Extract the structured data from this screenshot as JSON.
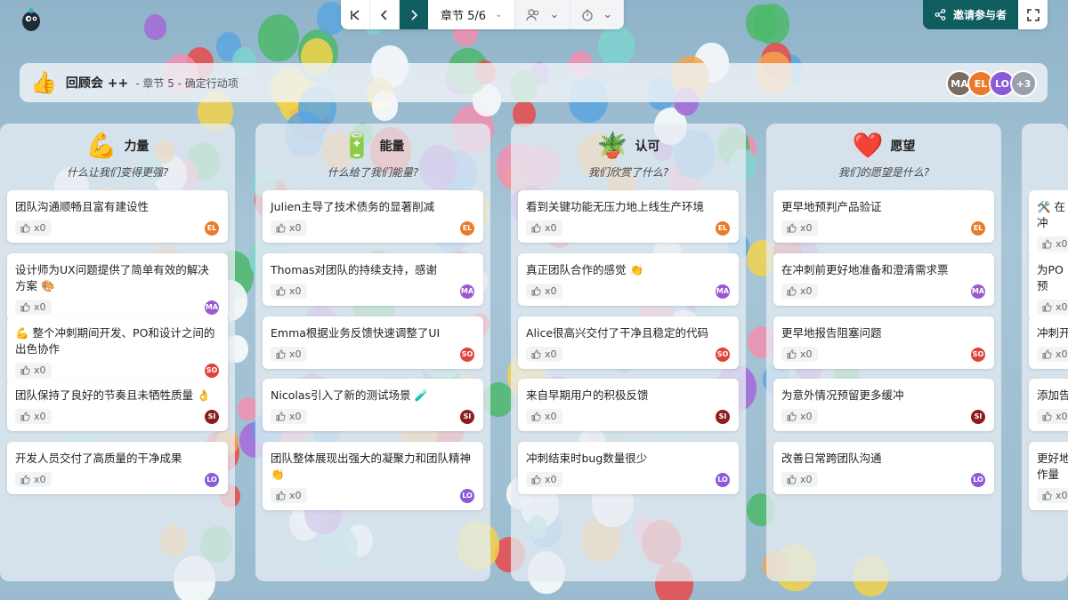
{
  "toolbar": {
    "chapter_label": "章节 5/6",
    "invite_label": "邀请参与者"
  },
  "header": {
    "title": "回顾会 ++",
    "subtitle": "- 章节 5 - 确定行动项",
    "participants": [
      {
        "initials": "MA",
        "color": "#7a6a60"
      },
      {
        "initials": "EL",
        "color": "#ea7a2a"
      },
      {
        "initials": "LO",
        "color": "#8a5ad8"
      },
      {
        "initials": "+3",
        "color": "#9aa1aa"
      }
    ]
  },
  "colors": {
    "primary": "#0f5d5e",
    "avatar_EL": "#ea7a2a",
    "avatar_MA": "#9b59d0",
    "avatar_SO": "#e0433a",
    "avatar_SI": "#8b1d1d",
    "avatar_LO": "#8a5ad8"
  },
  "columns": [
    {
      "title": "力量",
      "icon": "flexed-biceps-icon",
      "emoji": "💪",
      "question": "什么让我们变得更强?",
      "cards": [
        {
          "text": "团队沟通顺畅且富有建设性",
          "likes": "x0",
          "author": "EL"
        },
        {
          "text": "设计师为UX问题提供了简单有效的解决方案 🎨",
          "likes": "x0",
          "author": "MA"
        },
        {
          "text": "💪 整个冲刺期间开发、PO和设计之间的出色协作",
          "likes": "x0",
          "author": "SO"
        },
        {
          "text": "团队保持了良好的节奏且未牺牲质量 👌",
          "likes": "x0",
          "author": "SI"
        },
        {
          "text": "开发人员交付了高质量的干净成果",
          "likes": "x0",
          "author": "LO"
        }
      ]
    },
    {
      "title": "能量",
      "icon": "battery-icon",
      "emoji": "🔋",
      "question": "什么给了我们能量?",
      "cards": [
        {
          "text": "Julien主导了技术债务的显著削减",
          "likes": "x0",
          "author": "EL"
        },
        {
          "text": "Thomas对团队的持续支持，感谢",
          "likes": "x0",
          "author": "MA"
        },
        {
          "text": "Emma根据业务反馈快速调整了UI",
          "likes": "x0",
          "author": "SO"
        },
        {
          "text": "Nicolas引入了新的测试场景 🧪",
          "likes": "x0",
          "author": "SI"
        },
        {
          "text": "团队整体展现出强大的凝聚力和团队精神 👏",
          "likes": "x0",
          "author": "LO"
        }
      ]
    },
    {
      "title": "认可",
      "icon": "potted-plant-icon",
      "emoji": "🪴",
      "question": "我们欣赏了什么?",
      "cards": [
        {
          "text": "看到关键功能无压力地上线生产环境",
          "likes": "x0",
          "author": "EL"
        },
        {
          "text": "真正团队合作的感觉 👏",
          "likes": "x0",
          "author": "MA"
        },
        {
          "text": "Alice很高兴交付了干净且稳定的代码",
          "likes": "x0",
          "author": "SO"
        },
        {
          "text": "来自早期用户的积极反馈",
          "likes": "x0",
          "author": "SI"
        },
        {
          "text": "冲刺结束时bug数量很少",
          "likes": "x0",
          "author": "LO"
        }
      ]
    },
    {
      "title": "愿望",
      "icon": "heart-icon",
      "emoji": "❤️",
      "question": "我们的愿望是什么?",
      "cards": [
        {
          "text": "更早地预判产品验证",
          "likes": "x0",
          "author": "EL"
        },
        {
          "text": "在冲刺前更好地准备和澄清需求票",
          "likes": "x0",
          "author": "MA"
        },
        {
          "text": "更早地报告阻塞问题",
          "likes": "x0",
          "author": "SO"
        },
        {
          "text": "为意外情况预留更多缓冲",
          "likes": "x0",
          "author": "SI"
        },
        {
          "text": "改善日常跨团队沟通",
          "likes": "x0",
          "author": "LO"
        }
      ]
    },
    {
      "title": "",
      "question": "",
      "cards": [
        {
          "text": "🛠️ 在冲",
          "likes": "x0",
          "author": ""
        },
        {
          "text": "为PO预",
          "likes": "x0",
          "author": ""
        },
        {
          "text": "冲刺开",
          "likes": "x0",
          "author": ""
        },
        {
          "text": "添加告",
          "likes": "x0",
          "author": ""
        },
        {
          "text": "更好地作量",
          "likes": "x0",
          "author": ""
        }
      ]
    }
  ]
}
